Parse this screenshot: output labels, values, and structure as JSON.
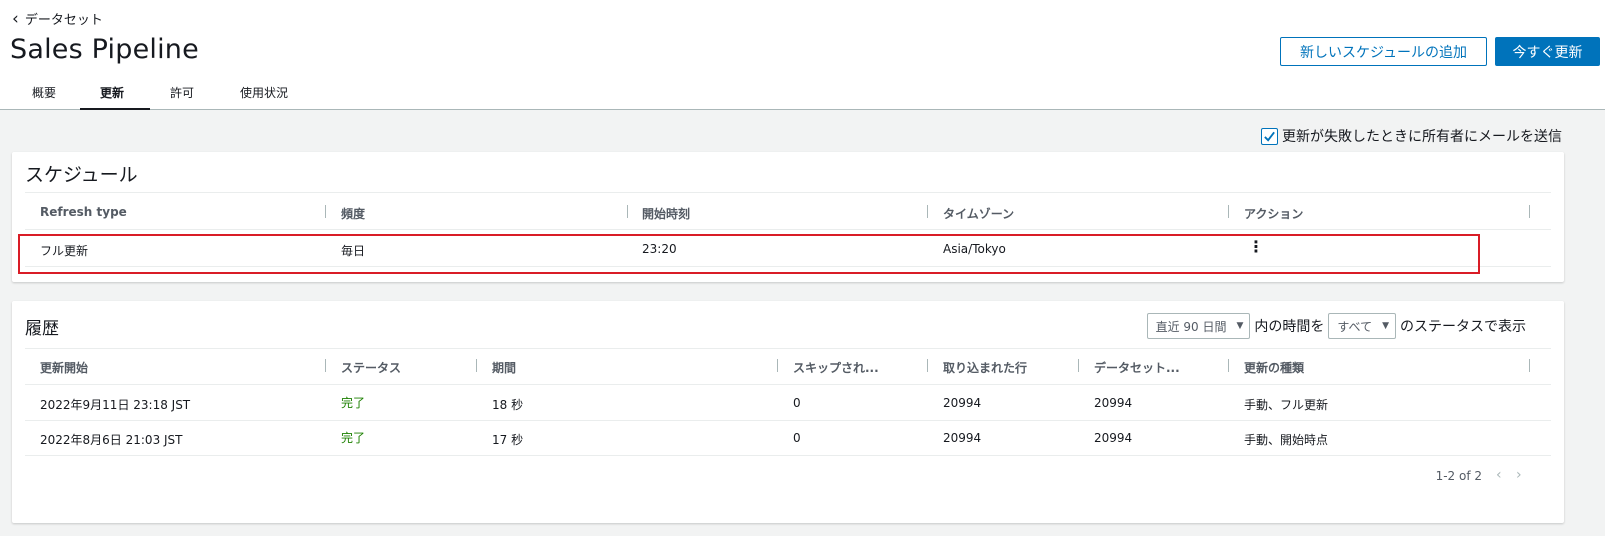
{
  "header": {
    "back_label": "データセット",
    "title": "Sales Pipeline",
    "add_schedule_label": "新しいスケジュールの追加",
    "refresh_now_label": "今すぐ更新"
  },
  "tabs": [
    {
      "label": "概要"
    },
    {
      "label": "更新"
    },
    {
      "label": "許可"
    },
    {
      "label": "使用状況"
    }
  ],
  "active_tab": "更新",
  "email_option": {
    "label": "更新が失敗したときに所有者にメールを送信",
    "checked": true
  },
  "schedule": {
    "title": "スケジュール",
    "columns": [
      "Refresh type",
      "頻度",
      "開始時刻",
      "タイムゾーン",
      "アクション"
    ],
    "rows": [
      {
        "type": "フル更新",
        "frequency": "毎日",
        "start": "23:20",
        "tz": "Asia/Tokyo"
      }
    ]
  },
  "history": {
    "title": "履歴",
    "range_select": "直近 90 日間",
    "text_mid": "内の時間を",
    "status_select": "すべて",
    "text_end": "のステータスで表示",
    "columns": [
      "更新開始",
      "ステータス",
      "期間",
      "スキップされ...",
      "取り込まれた行",
      "データセット...",
      "更新の種類"
    ],
    "rows": [
      {
        "start": "2022年9月11日 23:18 JST",
        "status": "完了",
        "duration": "18 秒",
        "skipped": "0",
        "ingested": "20994",
        "dataset": "20994",
        "kind": "手動、フル更新"
      },
      {
        "start": "2022年8月6日 21:03 JST",
        "status": "完了",
        "duration": "17 秒",
        "skipped": "0",
        "ingested": "20994",
        "dataset": "20994",
        "kind": "手動、開始時点"
      }
    ],
    "pagination": "1-2 of 2"
  },
  "colors": {
    "accent": "#0073bb",
    "success": "#1d8102",
    "highlight": "#d91c26"
  },
  "icons": {
    "back": "chevron-left-icon",
    "actions": "kebab-menu-icon",
    "prev": "chevron-left-icon",
    "next": "chevron-right-icon"
  }
}
